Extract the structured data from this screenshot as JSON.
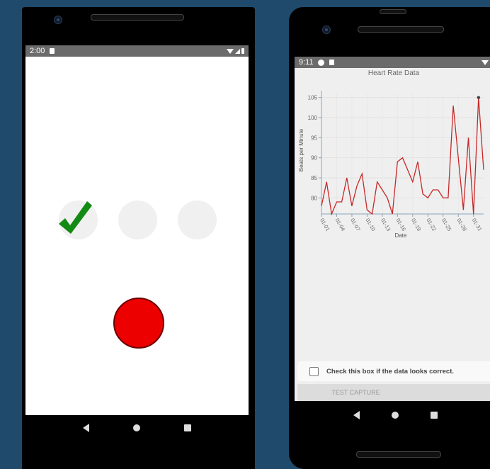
{
  "phone_left": {
    "status": {
      "time": "2:00"
    },
    "progress_dots": [
      {
        "state": "complete",
        "icon": "checkmark-icon"
      },
      {
        "state": "pending"
      },
      {
        "state": "pending"
      }
    ],
    "colors": {
      "check": "#138a13",
      "record": "#ec0000"
    }
  },
  "phone_right": {
    "status": {
      "time": "9:11"
    },
    "chart_title": "Heart Rate Data",
    "checkbox_label": "Check this box if the data looks correct.",
    "capture_label": "TEST CAPTURE"
  },
  "chart_data": {
    "type": "line",
    "title": "Heart Rate Data",
    "xlabel": "Date",
    "ylabel": "Beats per Minute",
    "ylim": [
      76,
      106
    ],
    "y_ticks": [
      "105",
      "100",
      "95",
      "90",
      "85",
      "80"
    ],
    "x_ticks": [
      "01-01",
      "01-04",
      "01-07",
      "01-10",
      "01-13",
      "01-16",
      "01-19",
      "01-22",
      "01-25",
      "01-28",
      "01-31"
    ],
    "series": [
      {
        "values": [
          78,
          84,
          76,
          79,
          79,
          85,
          78,
          83,
          86,
          77,
          76,
          84,
          82,
          80,
          76,
          89,
          90,
          87,
          84,
          89,
          81,
          80,
          82,
          82,
          80,
          80,
          103,
          90,
          77,
          95,
          76,
          105,
          87
        ]
      }
    ],
    "grid": true,
    "line_color": "#c62828"
  }
}
